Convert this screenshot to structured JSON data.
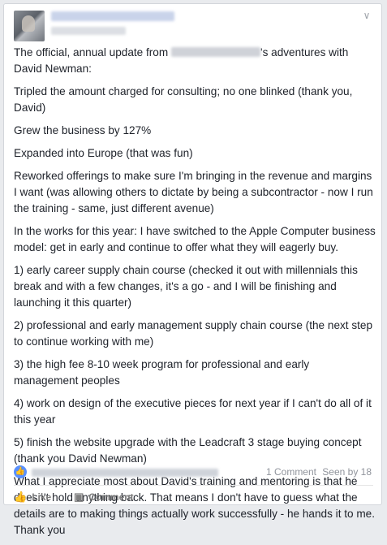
{
  "post": {
    "header": {
      "menu_icon": "chevron-down-icon"
    },
    "paragraphs": {
      "p1_before": "The official, annual update from",
      "p1_after": "'s adventures with David Newman:",
      "p2": "Tripled the amount charged for consulting; no one blinked (thank you, David)",
      "p3": "Grew the business by 127%",
      "p4": "Expanded into Europe (that was fun)",
      "p5": "Reworked offerings to make sure I'm bringing in the revenue and margins I want (was allowing others to dictate by being a subcontractor - now I run the training - same, just different avenue)",
      "p6": "In the works for this year: I have switched to the Apple Computer business model: get in early and continue to offer what they will eagerly buy.",
      "p7": "1) early career supply chain course (checked it out with millennials this break and with a few changes, it's a go - and I will be finishing and launching it this quarter)",
      "p8": "2) professional and early management supply chain course (the next step to continue working with me)",
      "p9": "3) the high fee 8-10 week program for professional and early management peoples",
      "p10": "4) work on design of the executive pieces for next year if I can't do all of it this year",
      "p11": "5) finish the website upgrade with the Leadcraft 3 stage buying concept (thank you David Newman)",
      "p12": "What I appreciate most about David's training and mentoring is that he doesn't hold anything back. That means I don't have to guess what the details are to making things actually work successfully - he hands it to me. Thank you"
    },
    "stats": {
      "like_icon": "thumbs-up-icon",
      "comments": "1 Comment",
      "seen_by": "Seen by 18"
    },
    "actions": {
      "like_label": "Like",
      "comment_label": "Comment"
    },
    "colors": {
      "background": "#e9ebee",
      "card": "#ffffff",
      "like_blue": "#5890ff",
      "text": "#1d2129",
      "muted": "#90949c"
    }
  }
}
